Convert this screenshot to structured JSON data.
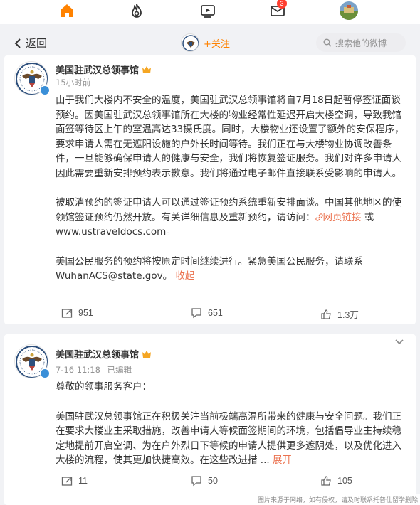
{
  "topnav": {
    "items": [
      {
        "name": "home",
        "icon": "home-icon"
      },
      {
        "name": "hot",
        "icon": "fire-icon"
      },
      {
        "name": "video",
        "icon": "video-icon"
      },
      {
        "name": "messages",
        "icon": "mail-icon",
        "badge": "3"
      },
      {
        "name": "me",
        "icon": "avatar"
      }
    ],
    "accent": "#ff8200"
  },
  "header": {
    "back_label": "返回",
    "follow_label": "+关注",
    "search_placeholder": "搜索他的微博"
  },
  "posts": [
    {
      "author": "美国驻武汉总领事馆",
      "time": "15小时前",
      "edited": "",
      "paragraphs": [
        "由于我们大楼内不安全的温度，美国驻武汉总领事馆将自7月18日起暂停签证面谈预约。因美国驻武汉总领事馆所在大楼的物业经常性延迟开启大楼空调，导致我馆面签等待区上午的室温高达33摄氏度。同时，大楼物业还设置了额外的安保程序，要求申请人需在无遮阳设施的户外长时间等待。我们正在与大楼物业协调改善条件，一旦能够确保申请人的健康与安全，我们将恢复签证服务。我们对许多申请人因此需要重新安排预约表示歉意。我们将通过电子邮件直接联系受影响的申请人。",
        "被取消预约的签证申请人可以通过签证预约系统重新安排面谈。中国其他地区的使领馆签证预约仍然开放。有关详细信息及重新预约，请访问：",
        "美国公民服务的预约将按原定时间继续进行。紧急美国公民服务，请联系WuhanACS@state.gov。"
      ],
      "link_label": "网页链接",
      "link_suffix": " 或www.ustraveldocs.com。",
      "collapse_label": "收起",
      "reposts": "951",
      "comments": "651",
      "likes": "1.3万"
    },
    {
      "author": "美国驻武汉总领事馆",
      "time": "7-16 11:18",
      "edited": "已编辑",
      "greeting": "尊敬的领事服务客户：",
      "body": "美国驻武汉总领事馆正在积极关注当前极端高温所带来的健康与安全问题。我们正在要求大楼业主采取措施，改善申请人等候面签期间的环境，包括倡导业主持续稳定地提前开启空调、为在户外烈日下等候的申请人提供更多遮阴处，以及优化进入大楼的流程，使其更加快捷高效。在这些改进措",
      "expand_prefix": "... ",
      "expand_label": "展开",
      "reposts": "11",
      "comments": "50",
      "likes": "105"
    }
  ],
  "watermark": "图片来源于网络，如有侵权，请及时联系托普仕留学删除"
}
